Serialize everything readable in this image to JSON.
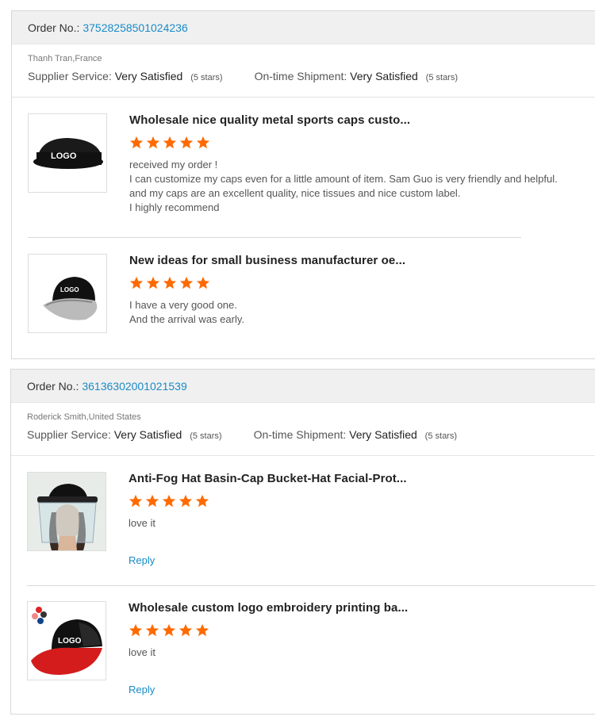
{
  "orders": [
    {
      "order_label": "Order No.:",
      "order_number": "37528258501024236",
      "buyer": "Thanh Tran,France",
      "supplier_label": "Supplier Service:",
      "supplier_value": "Very Satisfied",
      "supplier_stars": "(5 stars)",
      "shipment_label": "On-time Shipment:",
      "shipment_value": "Very Satisfied",
      "shipment_stars": "(5 stars)",
      "items": [
        {
          "title": "Wholesale nice quality metal sports caps custo...",
          "rating": 5,
          "review": [
            "received my order !",
            "I can customize my caps even for a little amount of item. Sam Guo is very friendly and helpful.",
            "and my caps are an excellent quality, nice tissues and nice custom label.",
            "I highly recommend"
          ],
          "thumb_text": "LOGO"
        },
        {
          "title": "New ideas for small business manufacturer oe...",
          "rating": 5,
          "review": [
            "I have a very good one.",
            "And the arrival was early."
          ],
          "thumb_text": "LOGO"
        }
      ]
    },
    {
      "order_label": "Order No.:",
      "order_number": "36136302001021539",
      "buyer": "Roderick Smith,United States",
      "supplier_label": "Supplier Service:",
      "supplier_value": "Very Satisfied",
      "supplier_stars": "(5 stars)",
      "shipment_label": "On-time Shipment:",
      "shipment_value": "Very Satisfied",
      "shipment_stars": "(5 stars)",
      "items": [
        {
          "title": "Anti-Fog Hat Basin-Cap Bucket-Hat Facial-Prot...",
          "rating": 5,
          "review": [
            "love it"
          ],
          "reply": "Reply"
        },
        {
          "title": "Wholesale custom logo embroidery printing ba...",
          "rating": 5,
          "review": [
            "love it"
          ],
          "reply": "Reply",
          "thumb_text": "LOGO"
        }
      ]
    }
  ],
  "colors": {
    "star": "#ff6a00",
    "link": "#1a8bc7"
  }
}
